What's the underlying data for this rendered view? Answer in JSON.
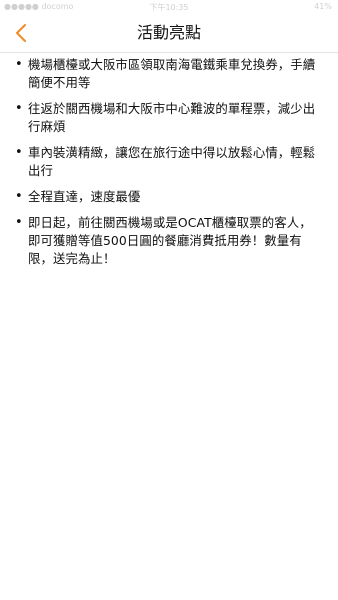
{
  "status_bar": {
    "carrier": "●●●●● docomo",
    "time": "下午10:35",
    "battery": "41%"
  },
  "header": {
    "title": "活動亮點",
    "back_icon": "chevron-left-icon",
    "accent_color": "#f08a24"
  },
  "highlights": [
    "機場櫃檯或大阪市區領取南海電鐵乘車兌換券，手續簡便不用等",
    "往返於關西機場和大阪市中心難波的單程票，減少出行麻煩",
    "車內裝潢精緻，讓您在旅行途中得以放鬆心情，輕鬆出行",
    "全程直達，速度最優",
    "即日起，前往關西機場或是OCAT櫃檯取票的客人，即可獲贈等值500日圓的餐廳消費抵用券！數量有限，送完為止！"
  ]
}
